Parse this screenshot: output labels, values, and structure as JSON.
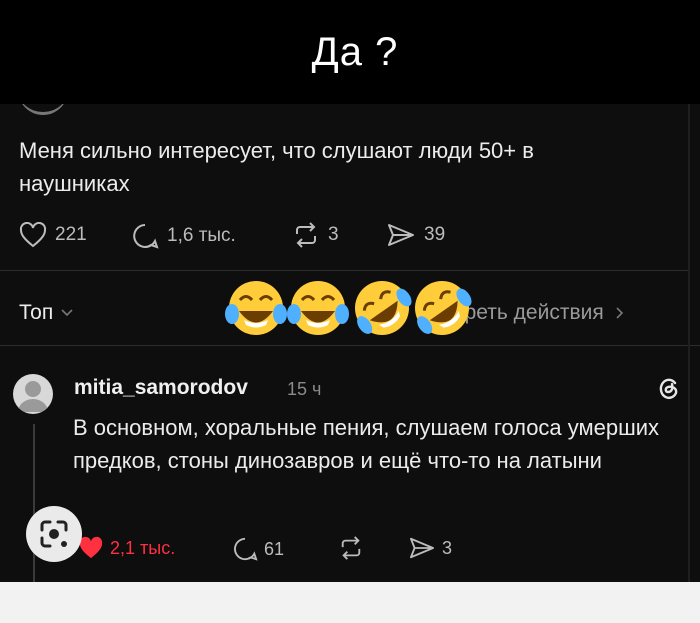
{
  "caption": {
    "title": "Да ?"
  },
  "post": {
    "text": "Меня сильно интересует, что слушают люди 50+ в наушниках",
    "likes": "221",
    "replies": "1,6 тыс.",
    "reposts": "3",
    "shares": "39"
  },
  "sort_bar": {
    "sort_label": "Топ",
    "actions_label": "треть действия"
  },
  "reply": {
    "username": "mitia_samorodov",
    "time": "15 ч",
    "text": "В основном, хоральные пения, слушаем голоса умерших предков, стоны динозавров и ещё что-то на латыни",
    "likes": "2,1 тыс.",
    "replies": "61",
    "shares": "3"
  },
  "icons": [
    "heart-icon",
    "comment-icon",
    "repost-icon",
    "share-icon",
    "threads-logo-icon",
    "chevron-down-icon",
    "chevron-right-icon",
    "lens-search-icon"
  ],
  "emojis": [
    "tears-of-joy",
    "tears-of-joy",
    "rolling-on-floor-laughing",
    "rolling-on-floor-laughing"
  ],
  "colors": {
    "like_active": "#ff3040",
    "emoji_yellow": "#ffcc3a",
    "background": "#0e0e0e"
  }
}
